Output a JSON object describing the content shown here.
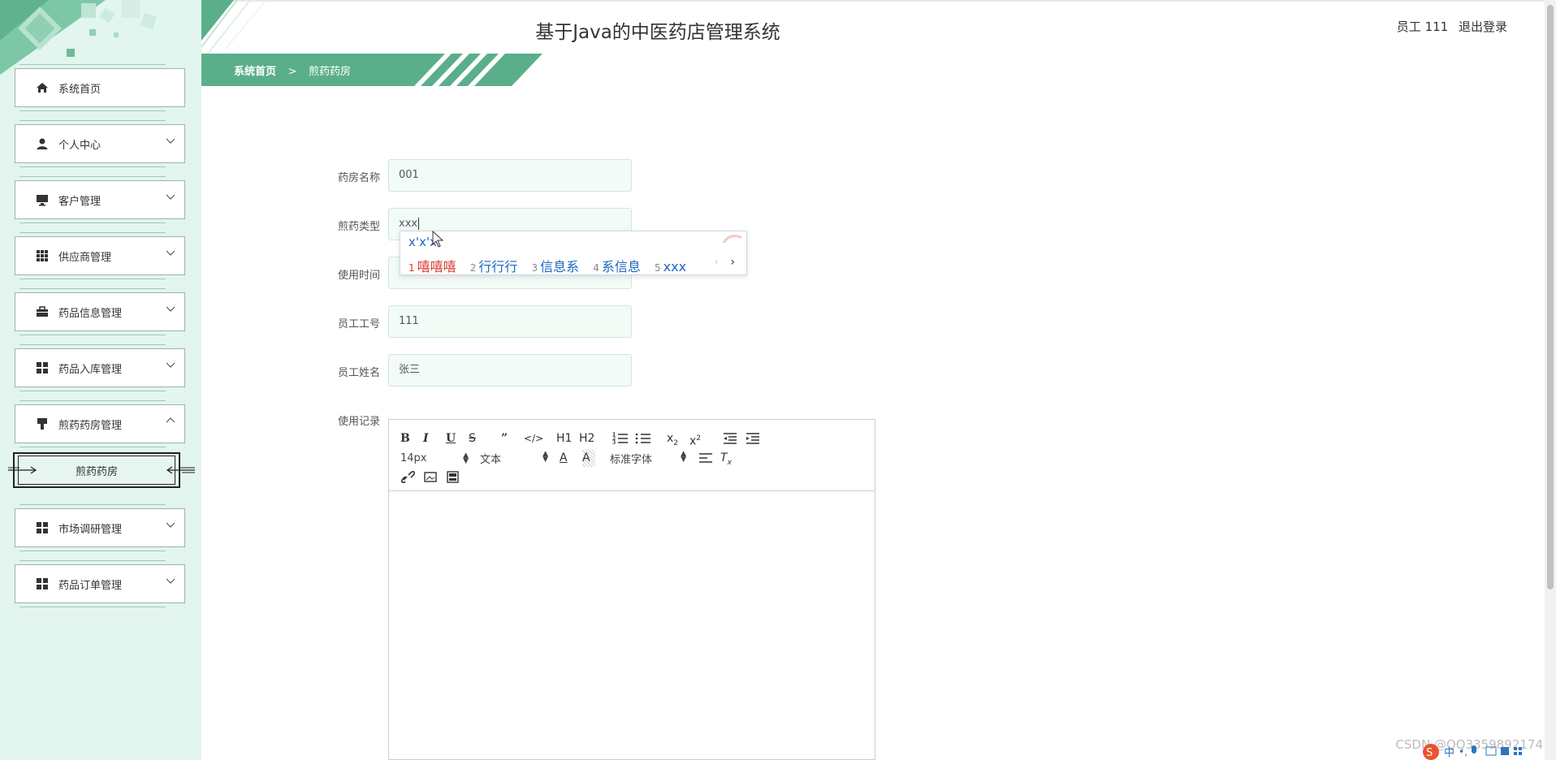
{
  "header": {
    "title": "基于Java的中医药店管理系统",
    "user_label": "员工 111",
    "logout_label": "退出登录"
  },
  "breadcrumb": {
    "home": "系统首页",
    "separator": ">",
    "current": "煎药药房"
  },
  "sidebar": {
    "items": [
      {
        "label": "系统首页",
        "icon": "home-icon",
        "expandable": false
      },
      {
        "label": "个人中心",
        "icon": "person-icon",
        "expandable": true
      },
      {
        "label": "客户管理",
        "icon": "monitor-icon",
        "expandable": true
      },
      {
        "label": "供应商管理",
        "icon": "grid-icon",
        "expandable": true
      },
      {
        "label": "药品信息管理",
        "icon": "briefcase-icon",
        "expandable": true
      },
      {
        "label": "药品入库管理",
        "icon": "grid4-icon",
        "expandable": true
      },
      {
        "label": "煎药药房管理",
        "icon": "brush-icon",
        "expandable": true,
        "expanded": true
      },
      {
        "label": "市场调研管理",
        "icon": "grid4-icon",
        "expandable": true
      },
      {
        "label": "药品订单管理",
        "icon": "grid4-icon",
        "expandable": true
      }
    ],
    "subitem": {
      "label": "煎药药房"
    }
  },
  "form": {
    "pharmacy_name": {
      "label": "药房名称",
      "value": "001"
    },
    "decoction_type": {
      "label": "煎药类型",
      "value": "xxx"
    },
    "use_time": {
      "label": "使用时间"
    },
    "staff_id": {
      "label": "员工工号",
      "value": "111"
    },
    "staff_name": {
      "label": "员工姓名",
      "value": "张三"
    },
    "use_record": {
      "label": "使用记录"
    }
  },
  "ime": {
    "pinyin": "x'x'x",
    "candidates": [
      {
        "num": "1",
        "text": "嘻嘻嘻"
      },
      {
        "num": "2",
        "text": "行行行"
      },
      {
        "num": "3",
        "text": "信息系"
      },
      {
        "num": "4",
        "text": "系信息"
      },
      {
        "num": "5",
        "text": "xxx"
      }
    ],
    "prev": "‹",
    "next": "›"
  },
  "editor": {
    "font_size": "14px",
    "block_type": "文本",
    "font_family": "标准字体",
    "heading1": "H1",
    "heading2": "H2"
  },
  "watermark": "CSDN @QQ3359892174",
  "colors": {
    "accent": "#5aaf8a",
    "sidebar_bg": "#e2f5ee",
    "ime_highlight": "#d9362b",
    "ime_text": "#1c66c4"
  }
}
